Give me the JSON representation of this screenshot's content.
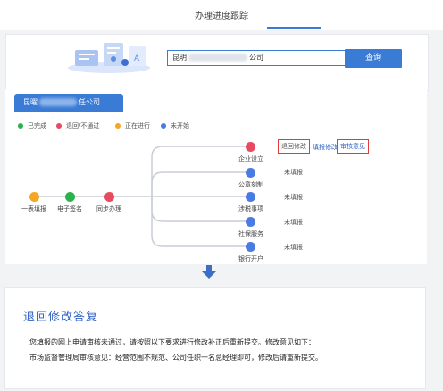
{
  "header": {
    "title": "办理进度跟踪"
  },
  "search": {
    "prefix": "昆明",
    "suffix": "公司",
    "button_label": "查询"
  },
  "company_tab": {
    "prefix": "昆曜",
    "suffix": "任公司"
  },
  "legend": [
    {
      "label": "已完成",
      "color": "#2bb24c"
    },
    {
      "label": "退回/不通过",
      "color": "#e84a5f"
    },
    {
      "label": "正在进行",
      "color": "#f5a623"
    },
    {
      "label": "未开始",
      "color": "#4a7be3"
    }
  ],
  "pipeline": [
    {
      "label": "一表填报",
      "color": "#f5a623"
    },
    {
      "label": "电子签名",
      "color": "#2bb24c"
    },
    {
      "label": "同步办理",
      "color": "#e84a5f"
    }
  ],
  "branches": [
    {
      "label": "企业设立",
      "color": "#e84a5f",
      "status": "退回修改",
      "link_edit": "填报修改",
      "link_review": "审核意见"
    },
    {
      "label": "公章刻制",
      "color": "#4a7be3",
      "status": "未填报"
    },
    {
      "label": "涉税事项",
      "color": "#4a7be3",
      "status": "未填报"
    },
    {
      "label": "社保服务",
      "color": "#4a7be3",
      "status": "未填报"
    },
    {
      "label": "银行开户",
      "color": "#4a7be3",
      "status": "未填报"
    }
  ],
  "reply": {
    "title": "退回修改答复",
    "line1": "您填报的网上申请审核未通过，请按照以下要求进行修改补正后重新提交。修改意见如下：",
    "line2": "市场监督管理局审核意见：经营范围不规范、公司任职一名总经理即可，修改后请重新提交。"
  }
}
